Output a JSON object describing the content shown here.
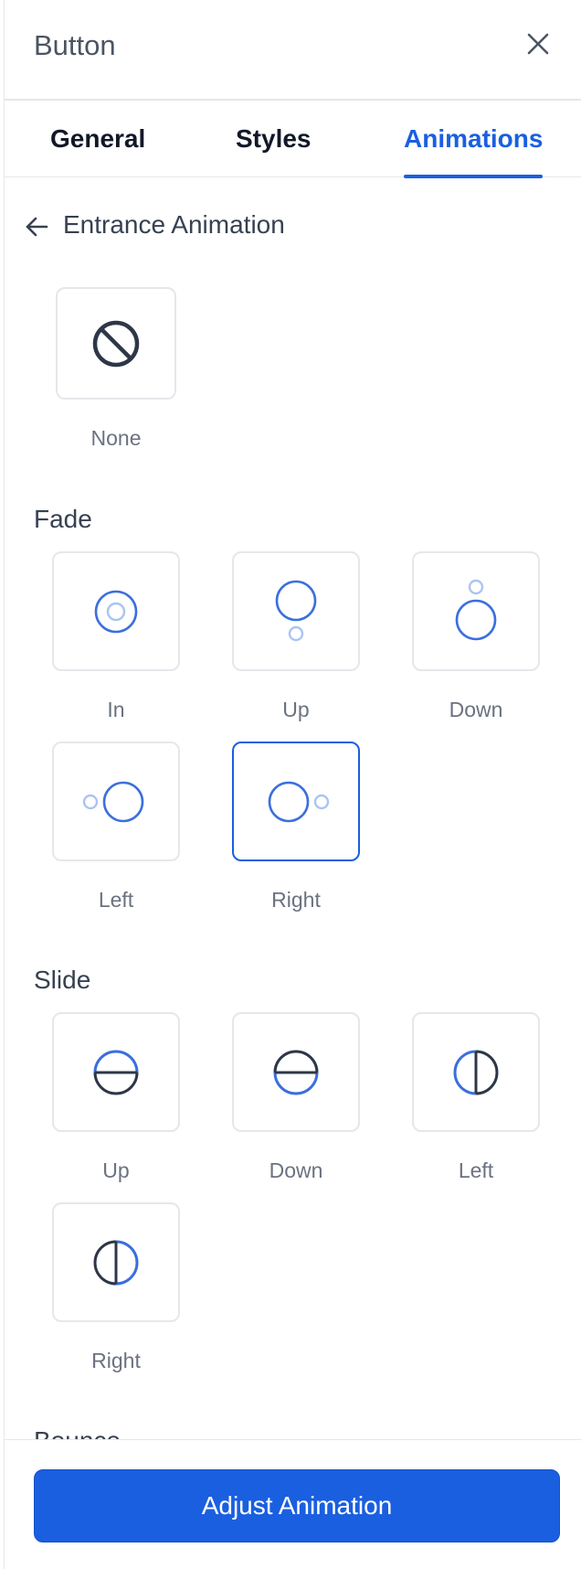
{
  "header": {
    "title": "Button"
  },
  "tabs": [
    {
      "label": "General"
    },
    {
      "label": "Styles"
    },
    {
      "label": "Animations"
    }
  ],
  "section": {
    "title": "Entrance Animation"
  },
  "none_option": {
    "label": "None"
  },
  "groups": {
    "fade": {
      "title": "Fade",
      "items": [
        {
          "label": "In"
        },
        {
          "label": "Up"
        },
        {
          "label": "Down"
        },
        {
          "label": "Left"
        },
        {
          "label": "Right"
        }
      ]
    },
    "slide": {
      "title": "Slide",
      "items": [
        {
          "label": "Up"
        },
        {
          "label": "Down"
        },
        {
          "label": "Left"
        },
        {
          "label": "Right"
        }
      ]
    },
    "bounce": {
      "title": "Bounce"
    }
  },
  "footer": {
    "cta_label": "Adjust Animation"
  },
  "colors": {
    "accent": "#1a5fe0",
    "accent_light": "#aac4f2",
    "icon_dark": "#2d3748"
  },
  "selected": "fade-right"
}
